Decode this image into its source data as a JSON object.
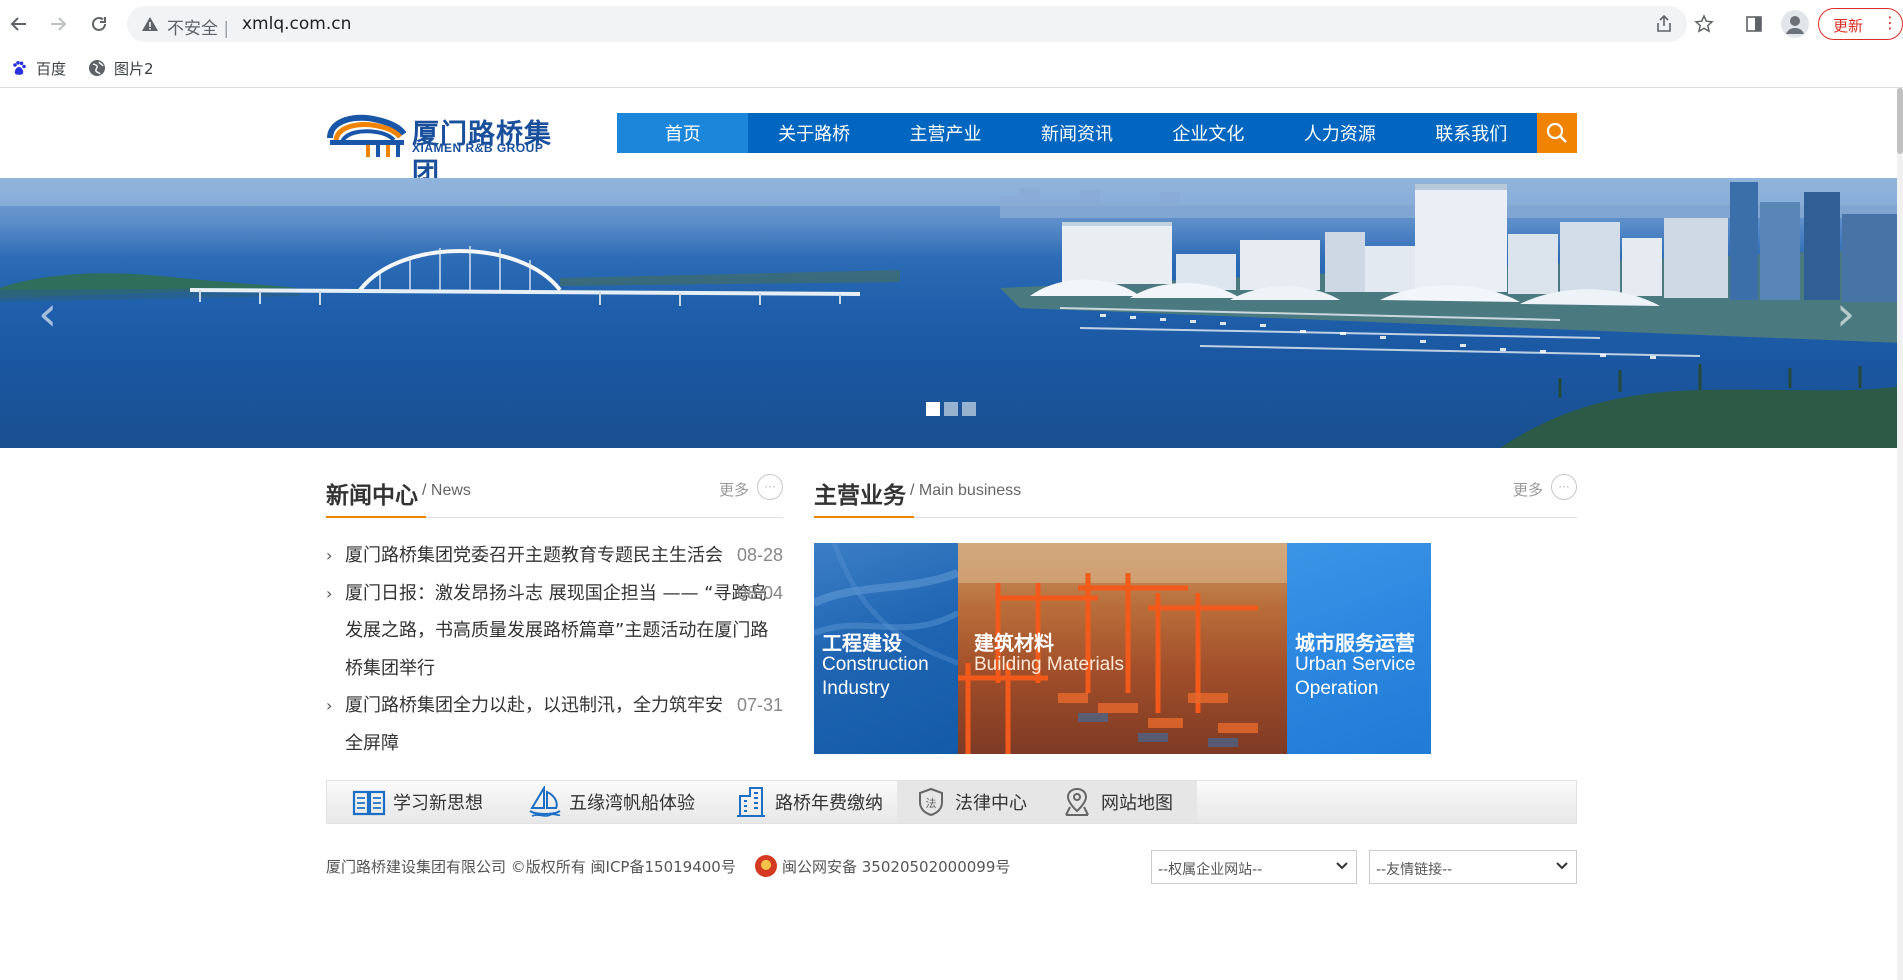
{
  "browser": {
    "security_label": "不安全",
    "separator": "|",
    "url": "xmlq.com.cn",
    "update_label": "更新",
    "bookmarks": [
      {
        "label": "百度",
        "icon": "baidu-paw-icon"
      },
      {
        "label": "图片2",
        "icon": "globe-icon"
      }
    ]
  },
  "site": {
    "logo_cn": "厦门路桥集团",
    "logo_en": "XIAMEN R&B GROUP",
    "nav": [
      {
        "label": "首页",
        "active": true
      },
      {
        "label": "关于路桥"
      },
      {
        "label": "主营产业"
      },
      {
        "label": "新闻资讯"
      },
      {
        "label": "企业文化"
      },
      {
        "label": "人力资源"
      },
      {
        "label": "联系我们"
      }
    ],
    "search_icon": "search-icon",
    "accent_color": "#f08300",
    "nav_color": "#0066c0"
  },
  "banner": {
    "prev_arrow": "‹",
    "next_arrow": "›",
    "slide_count": 3,
    "active_slide": 1
  },
  "news": {
    "title": "新闻中心",
    "subtitle": "/ News",
    "more": "更多",
    "items": [
      {
        "text": "厦门路桥集团党委召开主题教育专题民主生活会",
        "date": "08-28"
      },
      {
        "text": "厦门日报：激发昂扬斗志 展现国企担当 —— “寻跨岛发展之路，书高质量发展路桥篇章”主题活动在厦门路桥集团举行",
        "date": "08-04"
      },
      {
        "text": "厦门路桥集团全力以赴，以迅制汛，全力筑牢安全屏障",
        "date": "07-31"
      }
    ]
  },
  "business": {
    "title": "主营业务",
    "subtitle": "/ Main business",
    "more": "更多",
    "tiles": [
      {
        "cn": "工程建设",
        "en1": "Construction",
        "en2": "Industry"
      },
      {
        "cn": "建筑材料",
        "en1": "Building Materials",
        "en2": ""
      },
      {
        "cn": "城市服务运营",
        "en1": "Urban Service",
        "en2": "Operation"
      }
    ]
  },
  "quick_links": [
    {
      "label": "学习新思想",
      "icon": "open-book-icon"
    },
    {
      "label": "五缘湾帆船体验",
      "icon": "sailboat-icon"
    },
    {
      "label": "路桥年费缴纳",
      "icon": "building-icon"
    },
    {
      "label": "法律中心",
      "icon": "law-shield-icon"
    },
    {
      "label": "网站地图",
      "icon": "map-pin-icon"
    }
  ],
  "footer": {
    "copyright": "厦门路桥建设集团有限公司 ©版权所有 闽ICP备15019400号",
    "police": "闽公网安备 35020502000099号",
    "select1": "--权属企业网站--",
    "select2": "--友情链接--"
  }
}
